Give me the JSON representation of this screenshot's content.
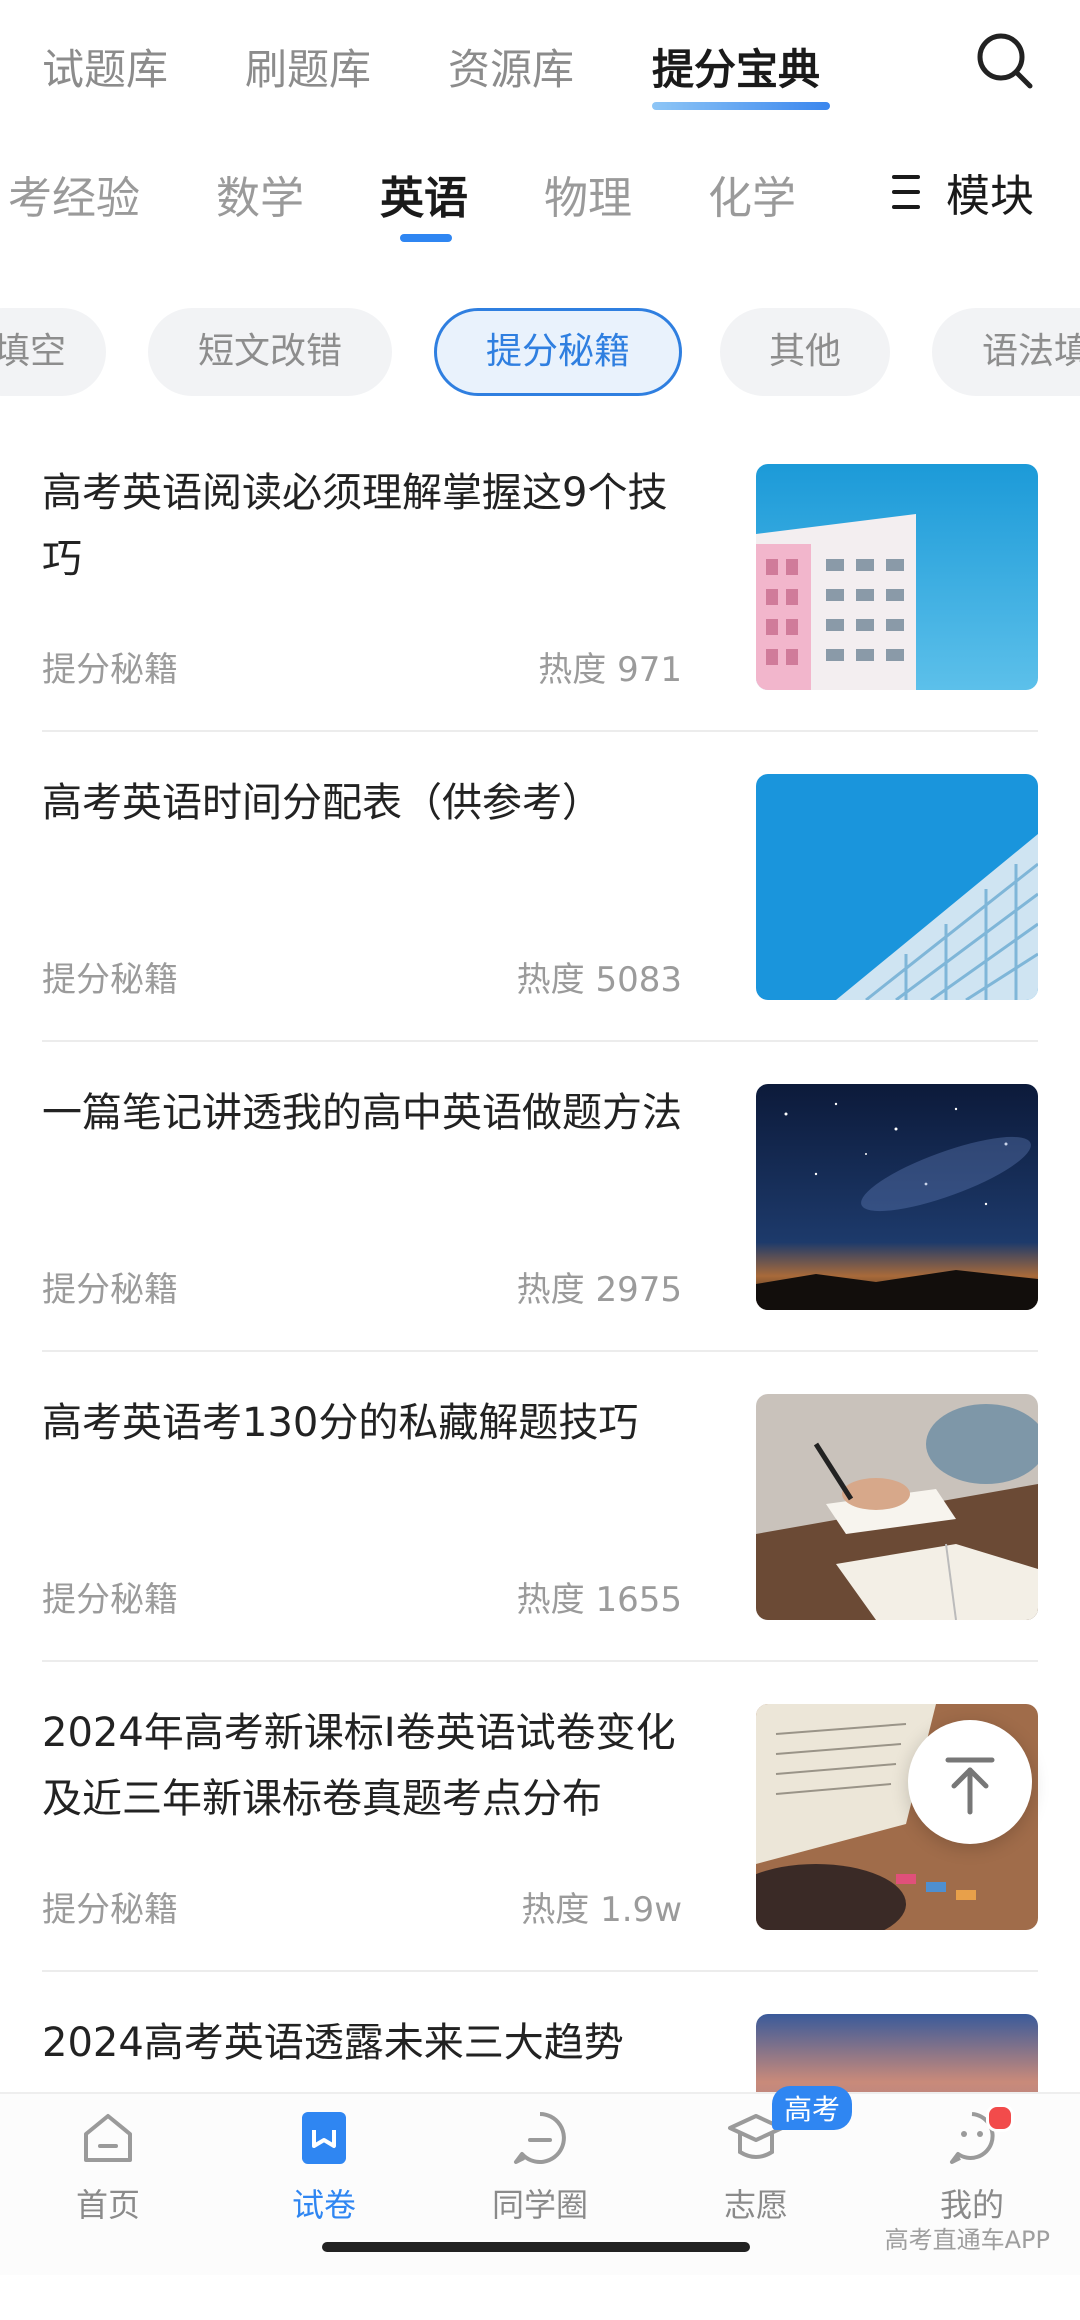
{
  "top_tabs": [
    "试题库",
    "刷题库",
    "资源库",
    "提分宝典"
  ],
  "subject_tabs": [
    "考经验",
    "数学",
    "英语",
    "物理",
    "化学"
  ],
  "module_label": "模块",
  "chips": [
    "填空",
    "短文改错",
    "提分秘籍",
    "其他",
    "语法填"
  ],
  "articles": [
    {
      "title": "高考英语阅读必须理解掌握这9个技巧",
      "tag": "提分秘籍",
      "heat": "热度 971",
      "thumb": "building-pink"
    },
    {
      "title": "高考英语时间分配表（供参考）",
      "tag": "提分秘籍",
      "heat": "热度 5083",
      "thumb": "building-blue"
    },
    {
      "title": "一篇笔记讲透我的高中英语做题方法",
      "tag": "提分秘籍",
      "heat": "热度 2975",
      "thumb": "starry-sky"
    },
    {
      "title": "高考英语考130分的私藏解题技巧",
      "tag": "提分秘籍",
      "heat": "热度 1655",
      "thumb": "writing-hands"
    },
    {
      "title": "2024年高考新课标I卷英语试卷变化及近三年新课标卷真题考点分布",
      "tag": "提分秘籍",
      "heat": "热度 1.9w",
      "thumb": "open-book"
    },
    {
      "title": "2024高考英语透露未来三大趋势",
      "tag": "",
      "heat": "",
      "thumb": "sunset-sky"
    }
  ],
  "bottom_nav": [
    "首页",
    "试卷",
    "同学圈",
    "志愿",
    "我的"
  ],
  "badge": "高考",
  "watermark": "高考直通车APP",
  "colors": {
    "accent": "#2f86f2",
    "notification": "#f24b4b"
  }
}
